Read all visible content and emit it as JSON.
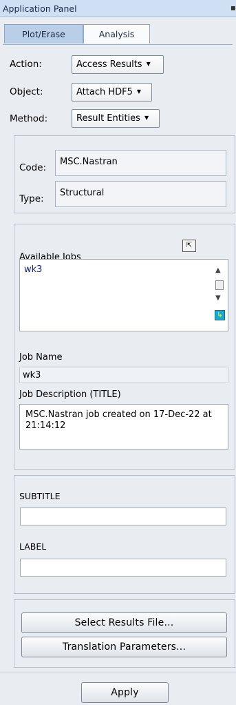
{
  "panel": {
    "title": "Application Panel"
  },
  "tabs": [
    {
      "label": "Plot/Erase"
    },
    {
      "label": "Analysis"
    }
  ],
  "action": {
    "label": "Action:",
    "value": "Access Results"
  },
  "object": {
    "label": "Object:",
    "value": "Attach HDF5"
  },
  "method": {
    "label": "Method:",
    "value": "Result Entities"
  },
  "code": {
    "label": "Code:",
    "value": "MSC.Nastran"
  },
  "type": {
    "label": "Type:",
    "value": "Structural"
  },
  "jobs": {
    "label": "Available Jobs",
    "items": [
      "wk3"
    ]
  },
  "job_name": {
    "label": "Job Name",
    "value": "wk3"
  },
  "job_description": {
    "label": "Job Description (TITLE)",
    "value": "MSC.Nastran job created on 17-Dec-22 at 21:14:12"
  },
  "subtitle": {
    "label": "SUBTITLE",
    "value": ""
  },
  "label_field": {
    "label": "LABEL",
    "value": ""
  },
  "buttons": {
    "select_results": "Select Results File...",
    "translation": "Translation Parameters...",
    "apply": "Apply"
  },
  "colors": {
    "accent": "#b9cfe9",
    "list_text": "#1a237e",
    "background": "#e9ecf1"
  }
}
